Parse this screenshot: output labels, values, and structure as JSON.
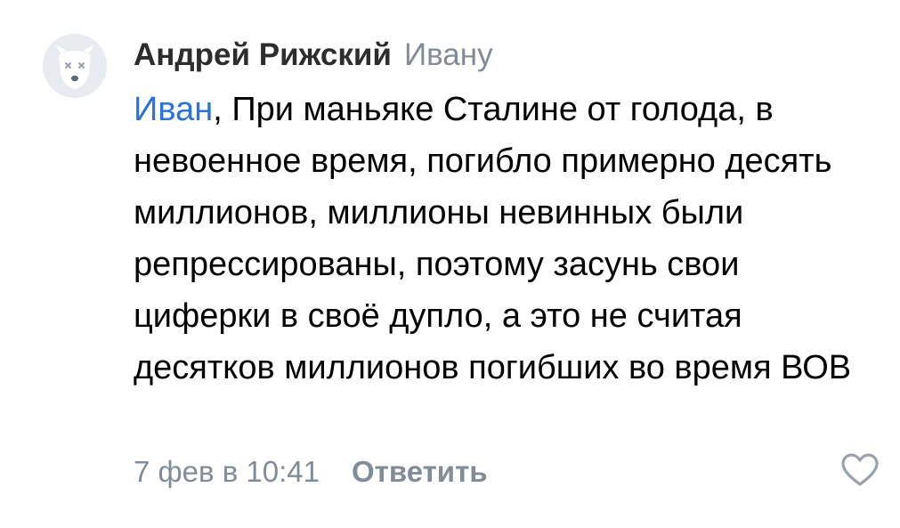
{
  "comment": {
    "author": "Андрей Рижский",
    "reply_to": "Ивану",
    "mention": "Иван",
    "text": ", При маньяке Сталине от голода, в невоенное время, погибло примерно десять миллионов, миллионы невинных были репрессированы, поэтому засунь свои циферки в своё дупло, а это не считая десятков миллионов погибших во время ВОВ",
    "date": "7 фев в 10:41",
    "reply_label": "Ответить",
    "like_icon": "heart-outline-icon",
    "avatar_icon": "deactivated-dog-avatar-icon"
  },
  "colors": {
    "author": "#2c2d2e",
    "secondary": "#818c99",
    "mention": "#2a73d9",
    "text": "#000000",
    "avatar_bg": "#e8ebef"
  }
}
